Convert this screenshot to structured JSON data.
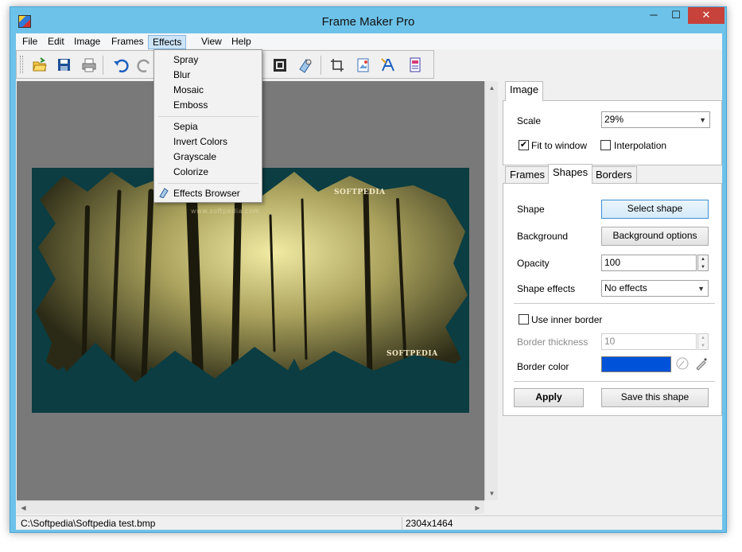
{
  "window": {
    "title": "Frame Maker Pro",
    "minimize": "─",
    "maximize": "☐",
    "close": "✕"
  },
  "menu": [
    "File",
    "Edit",
    "Image",
    "Frames",
    "Effects",
    "View",
    "Help"
  ],
  "effects_menu": {
    "group1": [
      "Spray",
      "Blur",
      "Mosaic",
      "Emboss"
    ],
    "group2": [
      "Sepia",
      "Invert Colors",
      "Grayscale",
      "Colorize"
    ],
    "group3": [
      "Effects Browser"
    ]
  },
  "toolbar_icons": [
    "open-folder-icon",
    "save-icon",
    "print-icon",
    "undo-icon",
    "redo-icon",
    "frame-icon",
    "shape-brush-icon",
    "crop-icon",
    "image-magic-icon",
    "text-icon",
    "document-icon"
  ],
  "image_tab": {
    "tab_label": "Image",
    "scale_label": "Scale",
    "scale_value": "29%",
    "fit_to_window": "Fit to window",
    "fit_checked": true,
    "interpolation": "Interpolation",
    "interpolation_checked": false
  },
  "shape_tabs": [
    "Frames",
    "Shapes",
    "Borders"
  ],
  "shapes": {
    "shape_label": "Shape",
    "select_shape": "Select shape",
    "background_label": "Background",
    "background_options": "Background options",
    "opacity_label": "Opacity",
    "opacity_value": "100",
    "effects_label": "Shape effects",
    "effects_value": "No effects",
    "inner_border": "Use inner border",
    "inner_border_checked": false,
    "thickness_label": "Border thickness",
    "thickness_value": "10",
    "color_label": "Border color",
    "border_color": "#0053d9",
    "apply": "Apply",
    "save_shape": "Save this shape"
  },
  "image": {
    "watermark1": "SOFTPEDIA",
    "watermark2": "SOFTPEDIA",
    "watermark_url": "www.softpedia.com"
  },
  "status": {
    "path": "C:\\Softpedia\\Softpedia test.bmp",
    "dimensions": "2304x1464"
  }
}
